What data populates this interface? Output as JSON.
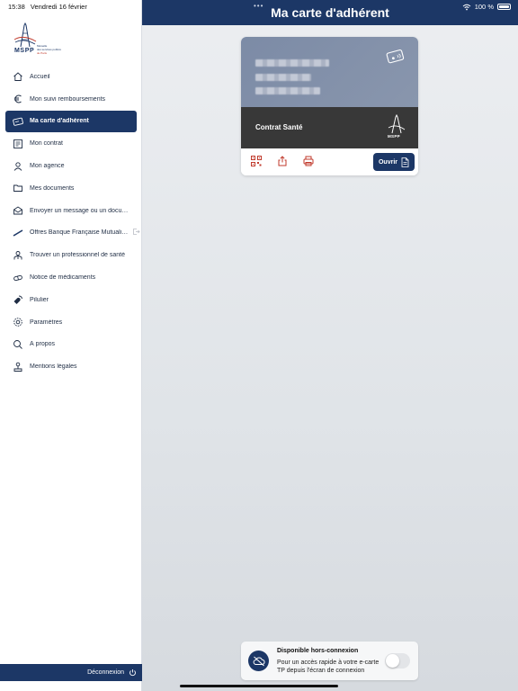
{
  "status_bar": {
    "time": "15:38",
    "date": "Vendredi 16 février",
    "battery": "100 %",
    "battery_level": 1.0
  },
  "logo": {
    "brand": "MSPP",
    "lines": [
      "Mutuelle",
      "des services publics",
      "de Paris"
    ]
  },
  "sidebar": {
    "items": [
      {
        "label": "Accueil",
        "icon": "home-icon",
        "active": false
      },
      {
        "label": "Mon suivi remboursements",
        "icon": "euro-icon",
        "active": false
      },
      {
        "label": "Ma carte d'adhérent",
        "icon": "card-icon",
        "active": true
      },
      {
        "label": "Mon contrat",
        "icon": "contract-icon",
        "active": false
      },
      {
        "label": "Mon agence",
        "icon": "agent-icon",
        "active": false
      },
      {
        "label": "Mes documents",
        "icon": "folder-icon",
        "active": false
      },
      {
        "label": "Envoyer un message ou un document",
        "icon": "mail-icon",
        "active": false
      },
      {
        "label": "Offres Banque Française Mutualiste",
        "icon": "bank-icon",
        "active": false,
        "external": true
      },
      {
        "label": "Trouver un professionnel de santé",
        "icon": "doctor-icon",
        "active": false
      },
      {
        "label": "Notice de médicaments",
        "icon": "pill-icon",
        "active": false
      },
      {
        "label": "Pilulier",
        "icon": "pillbox-icon",
        "active": false
      },
      {
        "label": "Paramètres",
        "icon": "gear-icon",
        "active": false
      },
      {
        "label": "À propos",
        "icon": "about-icon",
        "active": false
      },
      {
        "label": "Mentions légales",
        "icon": "legal-icon",
        "active": false
      }
    ],
    "logout_label": "Déconnexion"
  },
  "header": {
    "title": "Ma carte d'adhérent"
  },
  "card": {
    "contract_name": "Contrat Santé",
    "open_label": "Ouvrir",
    "band_brand": "MSPP"
  },
  "offline": {
    "title": "Disponible hors-connexion",
    "description": "Pour un accès rapide à votre e-carte TP depuis l'écran de connexion",
    "enabled": false
  },
  "colors": {
    "primary": "#1c3766",
    "card_top": "#7c8ba6",
    "card_band": "#383838",
    "accent_red": "#c0392b"
  }
}
